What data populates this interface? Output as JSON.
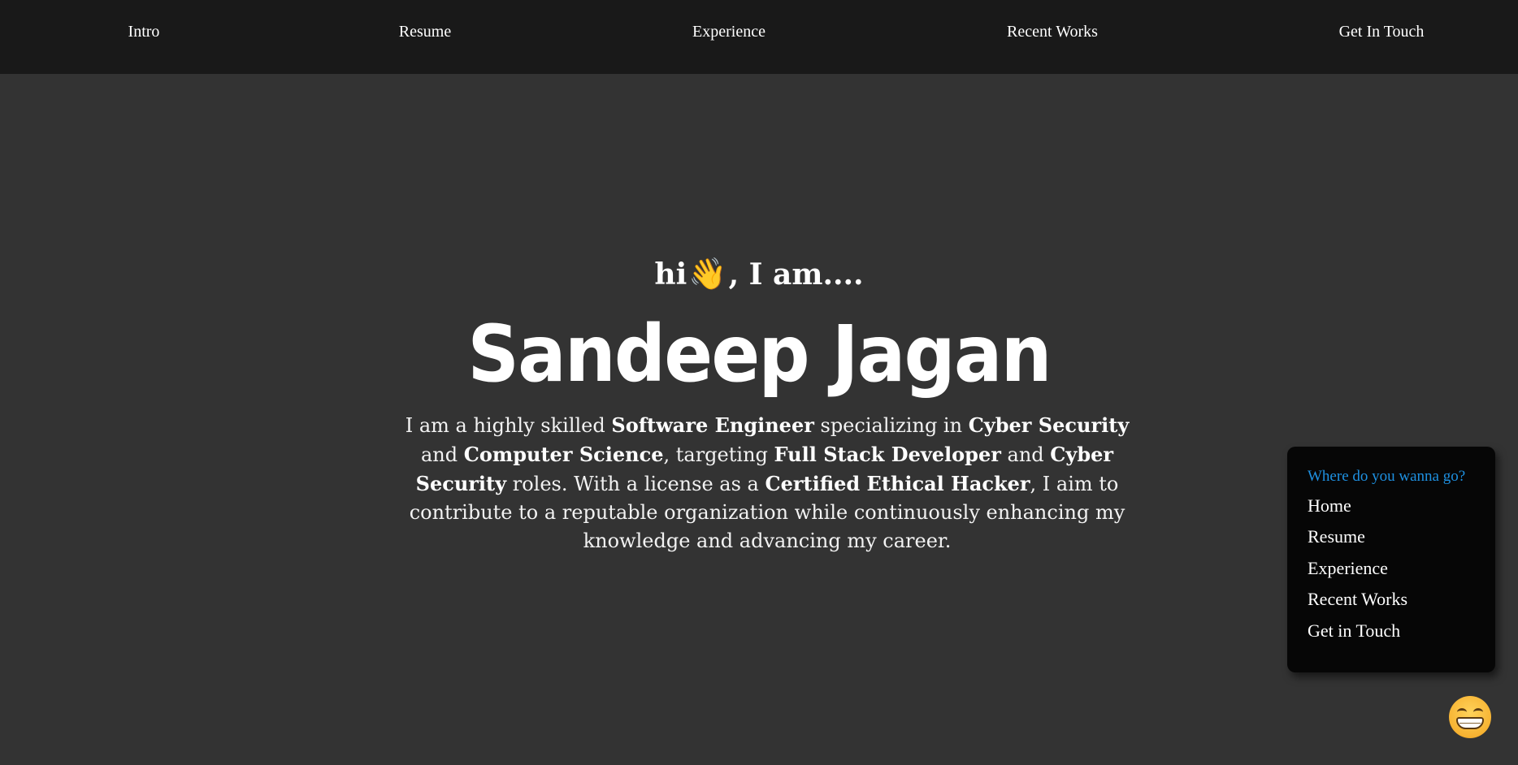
{
  "nav": {
    "items": [
      "Intro",
      "Resume",
      "Experience",
      "Recent Works",
      "Get In Touch"
    ]
  },
  "hero": {
    "greeting_prefix": "hi",
    "wave_icon": "waving-hand-icon",
    "wave_glyph": "👋",
    "greeting_suffix": ", I am....",
    "name": "Sandeep Jagan",
    "bio": {
      "t1": "I am a highly skilled ",
      "b1": "Software Engineer",
      "t2": " specializing in ",
      "b2": "Cyber Security",
      "t3": " and ",
      "b3": "Computer Science",
      "t4": ", targeting ",
      "b4": "Full Stack Developer",
      "t5": " and ",
      "b5": "Cyber Security",
      "t6": " roles. With a license as a ",
      "b6": "Certified Ethical Hacker",
      "t7": ", I aim to contribute to a reputable organization while continuously enhancing my knowledge and advancing my career."
    }
  },
  "quick_menu": {
    "title": "Where do you wanna go?",
    "items": [
      "Home",
      "Resume",
      "Experience",
      "Recent Works",
      "Get in Touch"
    ]
  },
  "emoji_button": {
    "icon": "grinning-face-icon"
  },
  "colors": {
    "nav_background": "#191919",
    "page_background": "#333333",
    "menu_background": "#060606",
    "menu_title": "#1e90e0",
    "text": "#ffffff"
  }
}
